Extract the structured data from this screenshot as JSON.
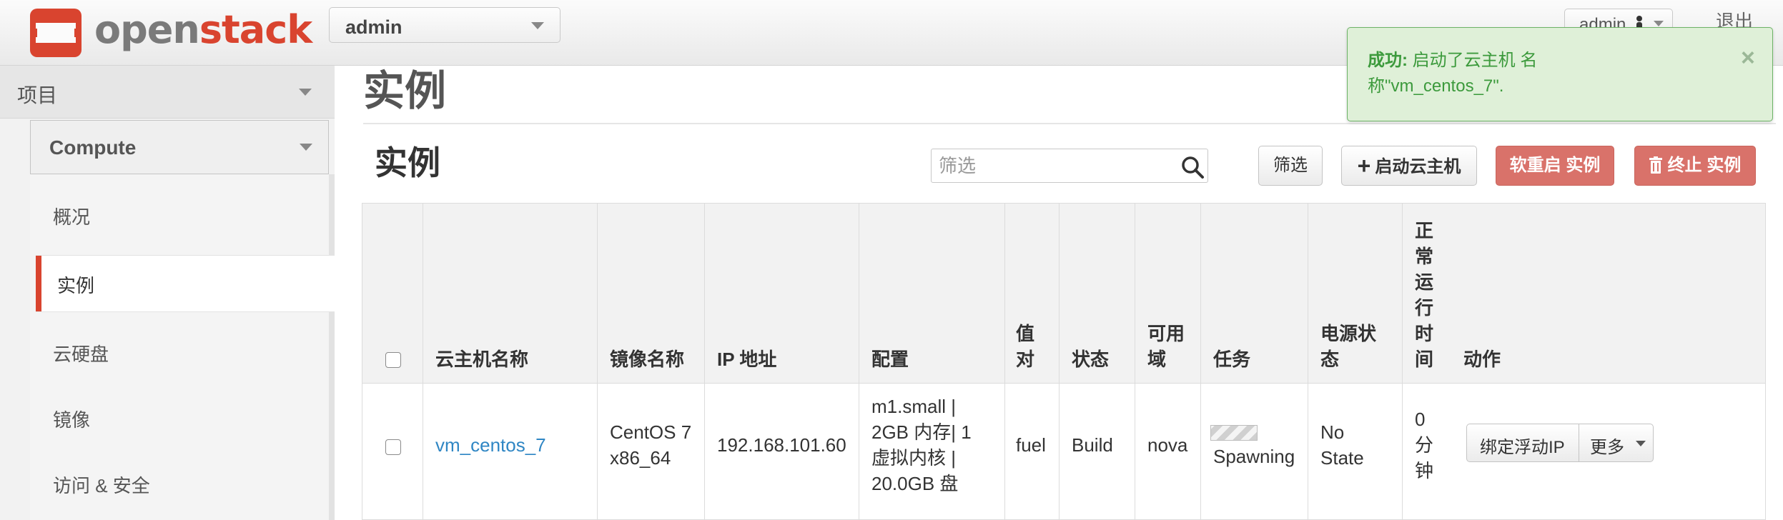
{
  "header": {
    "logo_text_open": "open",
    "logo_text_stack": "stack",
    "project_selector": "admin",
    "user_menu": "admin",
    "logout": "退出"
  },
  "sidebar": {
    "project": "项目",
    "compute": "Compute",
    "items": [
      "概况",
      "实例",
      "云硬盘",
      "镜像",
      "访问 & 安全"
    ],
    "active_index": 1
  },
  "main": {
    "page_title": "实例",
    "section_title": "实例",
    "filter_placeholder": "筛选",
    "filter_button": "筛选",
    "launch_button": "启动云主机",
    "reboot_button": "软重启 实例",
    "terminate_button": "终止 实例"
  },
  "table": {
    "headers": [
      "云主机名称",
      "镜像名称",
      "IP 地址",
      "配置",
      "值对",
      "状态",
      "可用域",
      "任务",
      "电源状态",
      "正常运行时间",
      "动作"
    ],
    "header_lines": {
      "keypair": [
        "值",
        "对"
      ],
      "az": [
        "可用",
        "域"
      ],
      "power": [
        "电源状",
        "态"
      ],
      "uptime": [
        "正",
        "常",
        "运",
        "行",
        "时",
        "间"
      ]
    },
    "rows": [
      {
        "name": "vm_centos_7",
        "image": [
          "CentOS 7",
          "x86_64"
        ],
        "ip": "192.168.101.60",
        "flavor": [
          "m1.small |",
          "2GB 内存| 1",
          "虚拟内核 |",
          "20.0GB 盘"
        ],
        "keypair": "fuel",
        "status": "Build",
        "az": "nova",
        "task": "Spawning",
        "power_state": [
          "No",
          "State"
        ],
        "uptime": [
          "0",
          "分",
          "钟"
        ],
        "action_primary": "绑定浮动IP",
        "action_more": "更多"
      }
    ]
  },
  "alert": {
    "title": "成功:",
    "message_line1": " 启动了云主机 名",
    "message_line2": "称\"vm_centos_7\".",
    "close": "×"
  },
  "colors": {
    "brand_red": "#d9442f",
    "link_blue": "#2f86c4",
    "success_green": "#3c9a3c",
    "danger_button": "#d9726a"
  }
}
